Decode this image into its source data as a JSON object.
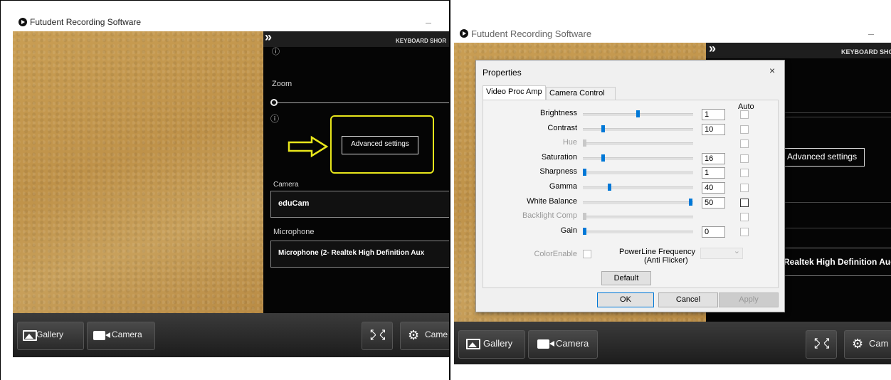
{
  "app": {
    "title": "Futudent Recording Software",
    "keyboard_shortcuts_label": "KEYBOARD SHOR"
  },
  "left": {
    "zoom_label": "Zoom",
    "advanced_settings_label": "Advanced settings",
    "camera_label": "Camera",
    "camera_value": "eduCam",
    "microphone_label": "Microphone",
    "microphone_value": "Microphone (2- Realtek High Definition Aux"
  },
  "bottom": {
    "gallery_label": "Gallery",
    "camera_label": "Camera",
    "camera_cut_label": "Came",
    "camera_cut_label_right": "Cam"
  },
  "right": {
    "advanced_settings_label": "Advanced settings",
    "microphone_value_cut": "Realtek High Definition Auc"
  },
  "dialog": {
    "title": "Properties",
    "close_glyph": "×",
    "tabs": [
      "Video Proc Amp",
      "Camera Control"
    ],
    "auto_label": "Auto",
    "properties": [
      {
        "label": "Brightness",
        "value": "1",
        "position": 0.5,
        "enabled": true
      },
      {
        "label": "Contrast",
        "value": "10",
        "position": 0.17,
        "enabled": true
      },
      {
        "label": "Hue",
        "value": "",
        "position": 0.0,
        "enabled": false
      },
      {
        "label": "Saturation",
        "value": "16",
        "position": 0.17,
        "enabled": true
      },
      {
        "label": "Sharpness",
        "value": "1",
        "position": 0.0,
        "enabled": true
      },
      {
        "label": "Gamma",
        "value": "40",
        "position": 0.23,
        "enabled": true
      },
      {
        "label": "White Balance",
        "value": "50",
        "position": 0.99,
        "enabled": true
      },
      {
        "label": "Backlight Comp",
        "value": "",
        "position": 0.0,
        "enabled": false
      },
      {
        "label": "Gain",
        "value": "0",
        "position": 0.0,
        "enabled": true
      }
    ],
    "color_enable_label": "ColorEnable",
    "powerline_label_1": "PowerLine Frequency",
    "powerline_label_2": "(Anti Flicker)",
    "default_button": "Default",
    "ok_button": "OK",
    "cancel_button": "Cancel",
    "apply_button": "Apply"
  }
}
